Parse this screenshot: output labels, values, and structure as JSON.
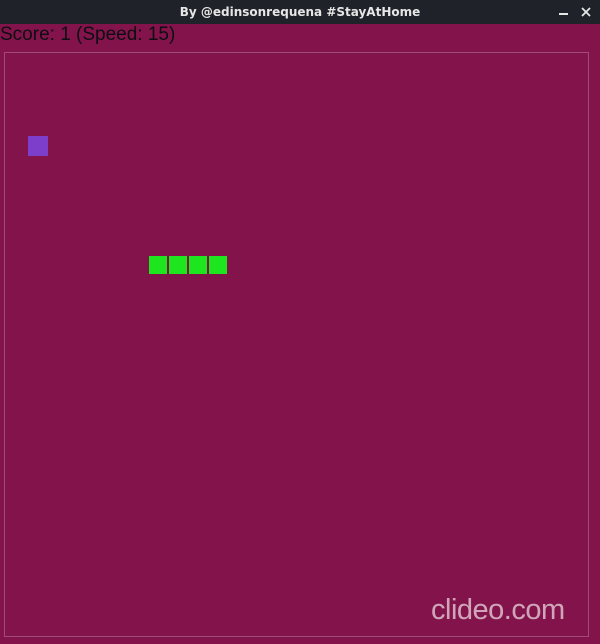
{
  "window": {
    "title": "By @edinsonrequena #StayAtHome",
    "minimize_icon": "minimize-icon",
    "close_icon": "close-icon"
  },
  "game": {
    "score_text": "Score: 1 (Speed: 15)",
    "score": 1,
    "speed": 15,
    "colors": {
      "background": "#83144b",
      "snake": "#1ee61e",
      "food": "#7d3fcb",
      "board_border": "#a04a74"
    },
    "snake_length": 4,
    "food_count": 1
  },
  "watermark": {
    "text": "clideo.com"
  }
}
